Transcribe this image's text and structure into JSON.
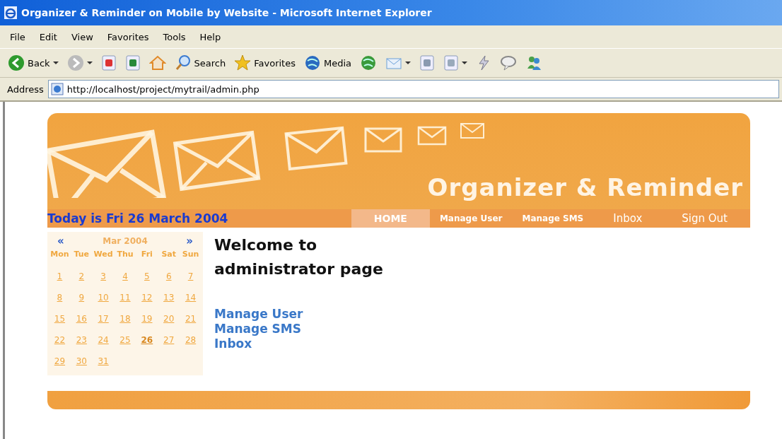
{
  "window": {
    "title": "Organizer & Reminder on Mobile by Website - Microsoft Internet Explorer"
  },
  "menu": [
    "File",
    "Edit",
    "View",
    "Favorites",
    "Tools",
    "Help"
  ],
  "toolbar": [
    {
      "kind": "back",
      "label": "Back",
      "dropdown": true
    },
    {
      "kind": "forward",
      "dropdown": true
    },
    {
      "kind": "stop"
    },
    {
      "kind": "refresh"
    },
    {
      "kind": "home"
    },
    {
      "kind": "search",
      "label": "Search"
    },
    {
      "kind": "favorites",
      "label": "Favorites"
    },
    {
      "kind": "media",
      "label": "Media"
    },
    {
      "kind": "history"
    },
    {
      "kind": "mail",
      "dropdown": true
    },
    {
      "kind": "print"
    },
    {
      "kind": "edit",
      "dropdown": true
    },
    {
      "kind": "research"
    },
    {
      "kind": "discuss"
    },
    {
      "kind": "messenger"
    }
  ],
  "address": {
    "label": "Address",
    "value": "http://localhost/project/mytrail/admin.php"
  },
  "banner": {
    "title": "Organizer & Reminder",
    "today": "Today is Fri 26 March 2004"
  },
  "nav": [
    {
      "label": "HOME",
      "selected": true
    },
    {
      "label": "Manage User",
      "selected": false
    },
    {
      "label": "Manage SMS",
      "selected": false
    },
    {
      "label": "Inbox",
      "selected": false
    },
    {
      "label": "Sign Out",
      "selected": false
    }
  ],
  "calendar": {
    "prev": "«",
    "month": "Mar 2004",
    "next": "»",
    "weekdays": [
      "Mon",
      "Tue",
      "Wed",
      "Thu",
      "Fri",
      "Sat",
      "Sun"
    ],
    "weeks": [
      [
        {
          "day": "1",
          "today": false
        },
        {
          "day": "2",
          "today": false
        },
        {
          "day": "3",
          "today": false
        },
        {
          "day": "4",
          "today": false
        },
        {
          "day": "5",
          "today": false
        },
        {
          "day": "6",
          "today": false
        },
        {
          "day": "7",
          "today": false
        }
      ],
      [
        {
          "day": "8",
          "today": false
        },
        {
          "day": "9",
          "today": false
        },
        {
          "day": "10",
          "today": false
        },
        {
          "day": "11",
          "today": false
        },
        {
          "day": "12",
          "today": false
        },
        {
          "day": "13",
          "today": false
        },
        {
          "day": "14",
          "today": false
        }
      ],
      [
        {
          "day": "15",
          "today": false
        },
        {
          "day": "16",
          "today": false
        },
        {
          "day": "17",
          "today": false
        },
        {
          "day": "18",
          "today": false
        },
        {
          "day": "19",
          "today": false
        },
        {
          "day": "20",
          "today": false
        },
        {
          "day": "21",
          "today": false
        }
      ],
      [
        {
          "day": "22",
          "today": false
        },
        {
          "day": "23",
          "today": false
        },
        {
          "day": "24",
          "today": false
        },
        {
          "day": "25",
          "today": false
        },
        {
          "day": "26",
          "today": true
        },
        {
          "day": "27",
          "today": false
        },
        {
          "day": "28",
          "today": false
        }
      ],
      [
        {
          "day": "29",
          "today": false
        },
        {
          "day": "30",
          "today": false
        },
        {
          "day": "31",
          "today": false
        }
      ]
    ]
  },
  "main": {
    "heading_lines": [
      "Welcome to",
      "administrator page"
    ],
    "links": [
      "Manage User",
      "Manage SMS",
      "Inbox"
    ]
  }
}
